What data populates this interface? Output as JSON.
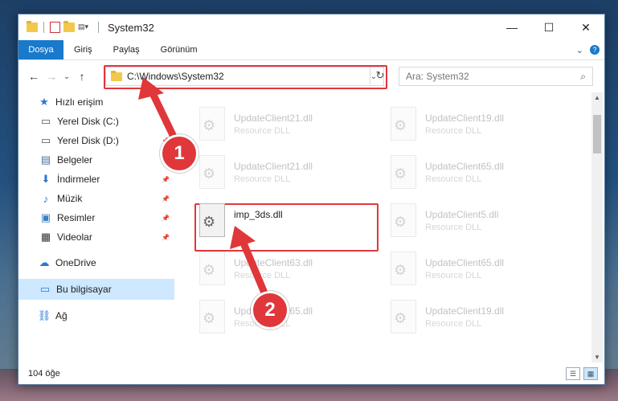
{
  "window": {
    "title": "System32",
    "controls": {
      "minimize": "—",
      "maximize": "☐",
      "close": "✕"
    }
  },
  "ribbon": {
    "tabs": [
      "Dosya",
      "Giriş",
      "Paylaş",
      "Görünüm"
    ],
    "help": "?"
  },
  "nav": {
    "back": "←",
    "forward": "→",
    "recent": "⌄",
    "up": "↑",
    "address": "C:\\Windows\\System32",
    "address_chevron": "⌄",
    "refresh": "↻",
    "search_placeholder": "Ara: System32",
    "search_icon": "⌕"
  },
  "sidebar": {
    "items": [
      {
        "label": "Hızlı erişim",
        "icon": "star-icon",
        "pinned": false,
        "indent": 0
      },
      {
        "label": "Yerel Disk (C:)",
        "icon": "drive-icon",
        "pinned": true,
        "indent": 1
      },
      {
        "label": "Yerel Disk (D:)",
        "icon": "drive-icon",
        "pinned": true,
        "indent": 1
      },
      {
        "label": "Belgeler",
        "icon": "documents-icon",
        "pinned": true,
        "indent": 1
      },
      {
        "label": "İndirmeler",
        "icon": "download-icon",
        "pinned": true,
        "indent": 1
      },
      {
        "label": "Müzik",
        "icon": "music-icon",
        "pinned": true,
        "indent": 1
      },
      {
        "label": "Resimler",
        "icon": "pictures-icon",
        "pinned": true,
        "indent": 1
      },
      {
        "label": "Videolar",
        "icon": "video-icon",
        "pinned": true,
        "indent": 1
      },
      {
        "label": "OneDrive",
        "icon": "cloud-icon",
        "pinned": false,
        "indent": 0
      },
      {
        "label": "Bu bilgisayar",
        "icon": "computer-icon",
        "pinned": false,
        "indent": 0,
        "selected": true
      },
      {
        "label": "Ağ",
        "icon": "network-icon",
        "pinned": false,
        "indent": 0
      }
    ]
  },
  "files": [
    {
      "name": "UpdateClient21.dll",
      "type": "Resource DLL",
      "active": false
    },
    {
      "name": "UpdateClient19.dll",
      "type": "Resource DLL",
      "active": false
    },
    {
      "name": "UpdateClient21.dll",
      "type": "Resource DLL",
      "active": false
    },
    {
      "name": "UpdateClient65.dll",
      "type": "Resource DLL",
      "active": false
    },
    {
      "name": "imp_3ds.dll",
      "type": "",
      "active": true
    },
    {
      "name": "UpdateClient5.dll",
      "type": "Resource DLL",
      "active": false
    },
    {
      "name": "UpdateClient63.dll",
      "type": "Resource DLL",
      "active": false
    },
    {
      "name": "UpdateClient65.dll",
      "type": "Resource DLL",
      "active": false
    },
    {
      "name": "UpdateClient65.dll",
      "type": "Resource DLL",
      "active": false
    },
    {
      "name": "UpdateClient19.dll",
      "type": "Resource DLL",
      "active": false
    }
  ],
  "status": {
    "count": "104 öğe"
  },
  "callouts": [
    "1",
    "2"
  ],
  "colors": {
    "accent": "#1979ca",
    "highlight": "#e0373b",
    "selected": "#cde8ff"
  }
}
